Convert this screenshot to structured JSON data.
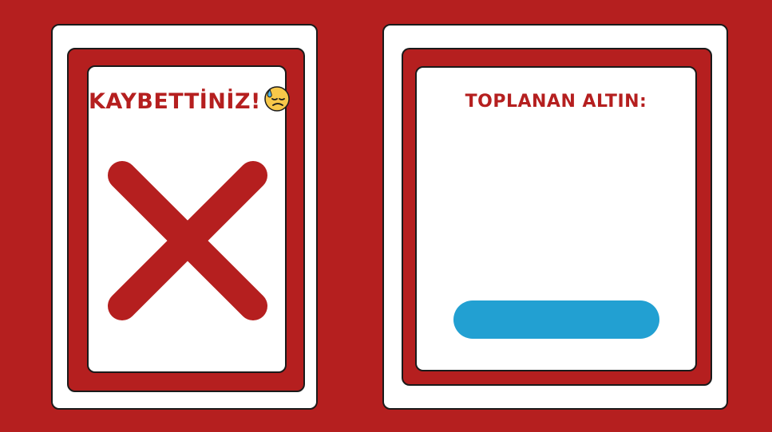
{
  "lose_panel": {
    "title": "KAYBETTİNİZ!",
    "emoji_icon": "sad-sweat-face-icon",
    "cross_icon": "red-x-icon"
  },
  "gold_panel": {
    "title": "TOPLANAN ALTIN:"
  },
  "colors": {
    "background": "#b51f1f",
    "accent_red": "#b51f1f",
    "bar_blue": "#22a0d2",
    "card_white": "#ffffff"
  }
}
